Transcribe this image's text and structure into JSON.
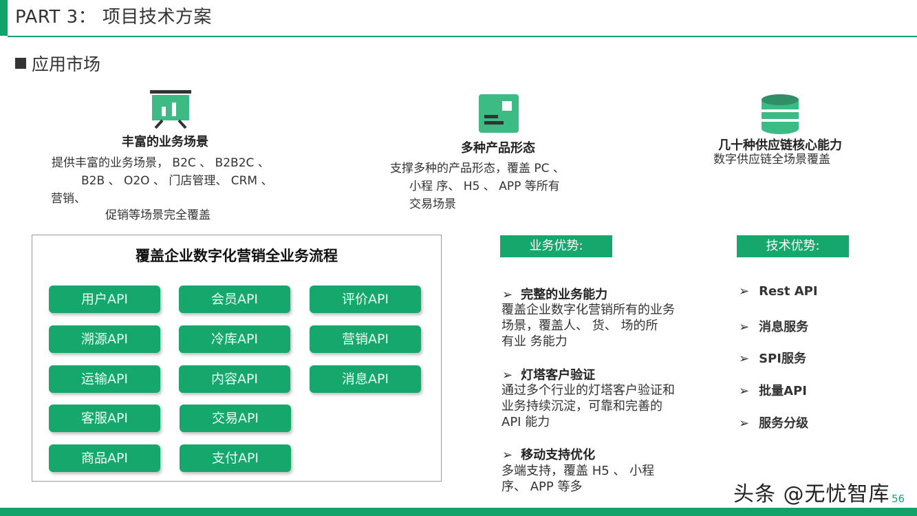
{
  "header": {
    "title": "PART 3： 项目技术方案",
    "section": "应用市场"
  },
  "features": [
    {
      "icon": "presentation-chart-icon",
      "title": "丰富的业务场景",
      "lines": [
        "提供丰富的业务场景， B2C 、   B2B2C 、",
        "B2B 、   O2O 、  门店管理、   CRM 、",
        "营销、",
        "促销等场景完全覆盖"
      ]
    },
    {
      "icon": "product-window-icon",
      "title": "多种产品形态",
      "lines": [
        "支撑多种的产品形态，覆盖 PC 、",
        "小程 序、   H5 、    APP 等所有",
        "交易场景"
      ]
    },
    {
      "icon": "database-icon",
      "title": "几十种供应链核心能力",
      "lines": [
        "数字供应链全场景覆盖"
      ]
    }
  ],
  "panel": {
    "title": "覆盖企业数字化营销全业务流程",
    "apis": [
      [
        "用户API",
        "会员API",
        "评价API"
      ],
      [
        "溯源API",
        "冷库API",
        "营销API"
      ],
      [
        "运输API",
        "内容API",
        "消息API"
      ],
      [
        "客服API",
        "交易API"
      ],
      [
        "商品API",
        "支付API"
      ]
    ]
  },
  "business": {
    "tag": "业务优势:",
    "items": [
      {
        "title": "完整的业务能力",
        "lines": [
          "覆盖企业数字化营销所有的业务",
          "场景，覆盖人、  货、  场的所",
          "有业 务能力"
        ]
      },
      {
        "title": "灯塔客户验证",
        "lines": [
          "通过多个行业的灯塔客户验证和",
          "业务持续沉淀，可靠和完善的",
          "API 能力"
        ]
      },
      {
        "title": "移动支持优化",
        "lines": [
          "多端支持，覆盖 H5 、   小程",
          "序、   APP 等多"
        ]
      }
    ]
  },
  "tech": {
    "tag": "技术优势:",
    "items": [
      "Rest API",
      "消息服务",
      "SPI服务",
      "批量API",
      "服务分级"
    ]
  },
  "footer": {
    "watermark": "头条 @无忧智库",
    "page_number": "56"
  },
  "colors": {
    "accent": "#12a36a",
    "button": "#16a76c"
  }
}
